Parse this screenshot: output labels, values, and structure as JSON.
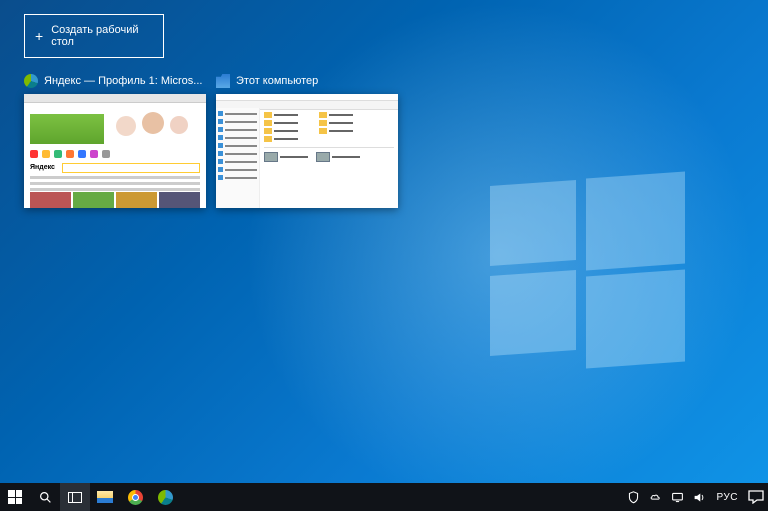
{
  "newDesktop": {
    "label": "Создать рабочий стол"
  },
  "windows": [
    {
      "title": "Яндекс — Профиль 1: Micros..."
    },
    {
      "title": "Этот компьютер"
    }
  ],
  "taskbar": {
    "language": "РУС"
  }
}
